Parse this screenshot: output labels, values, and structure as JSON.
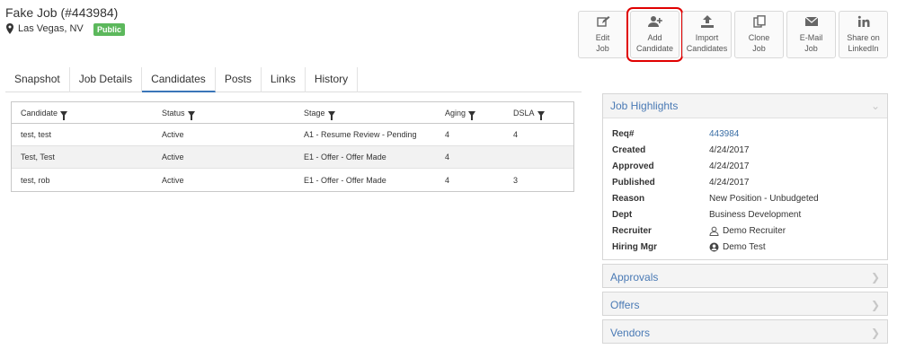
{
  "header": {
    "title": "Fake Job (#443984)",
    "location": "Las Vegas, NV",
    "badge": "Public"
  },
  "actions": [
    {
      "line1": "Edit",
      "line2": "Job",
      "icon": "edit-icon"
    },
    {
      "line1": "Add",
      "line2": "Candidate",
      "icon": "add-user-icon",
      "highlighted": true
    },
    {
      "line1": "Import",
      "line2": "Candidates",
      "icon": "upload-icon"
    },
    {
      "line1": "Clone",
      "line2": "Job",
      "icon": "copy-icon"
    },
    {
      "line1": "E-Mail",
      "line2": "Job",
      "icon": "envelope-icon"
    },
    {
      "line1": "Share on",
      "line2": "LinkedIn",
      "icon": "linkedin-icon"
    }
  ],
  "tabs": [
    "Snapshot",
    "Job Details",
    "Candidates",
    "Posts",
    "Links",
    "History"
  ],
  "active_tab": "Candidates",
  "table": {
    "columns": [
      "Candidate",
      "Status",
      "Stage",
      "Aging",
      "DSLA"
    ],
    "rows": [
      [
        "test, test",
        "Active",
        "A1 - Resume Review - Pending",
        "4",
        "4"
      ],
      [
        "Test, Test",
        "Active",
        "E1 - Offer - Offer Made",
        "4",
        ""
      ],
      [
        "test, rob",
        "Active",
        "E1 - Offer - Offer Made",
        "4",
        "3"
      ]
    ]
  },
  "highlights": {
    "title": "Job Highlights",
    "rows": [
      {
        "label": "Req#",
        "value": "443984",
        "link": true
      },
      {
        "label": "Created",
        "value": "4/24/2017"
      },
      {
        "label": "Approved",
        "value": "4/24/2017"
      },
      {
        "label": "Published",
        "value": "4/24/2017"
      },
      {
        "label": "Reason",
        "value": "New Position - Unbudgeted"
      },
      {
        "label": "Dept",
        "value": "Business Development"
      },
      {
        "label": "Recruiter",
        "value": "Demo Recruiter",
        "icon": "user-outline-icon"
      },
      {
        "label": "Hiring Mgr",
        "value": "Demo Test",
        "icon": "user-circle-icon"
      }
    ]
  },
  "panels": {
    "approvals": "Approvals",
    "offers": "Offers",
    "vendors": "Vendors"
  },
  "colors": {
    "accent": "#3a75b8",
    "badge": "#5cb85c",
    "highlight_outline": "#e00000"
  }
}
